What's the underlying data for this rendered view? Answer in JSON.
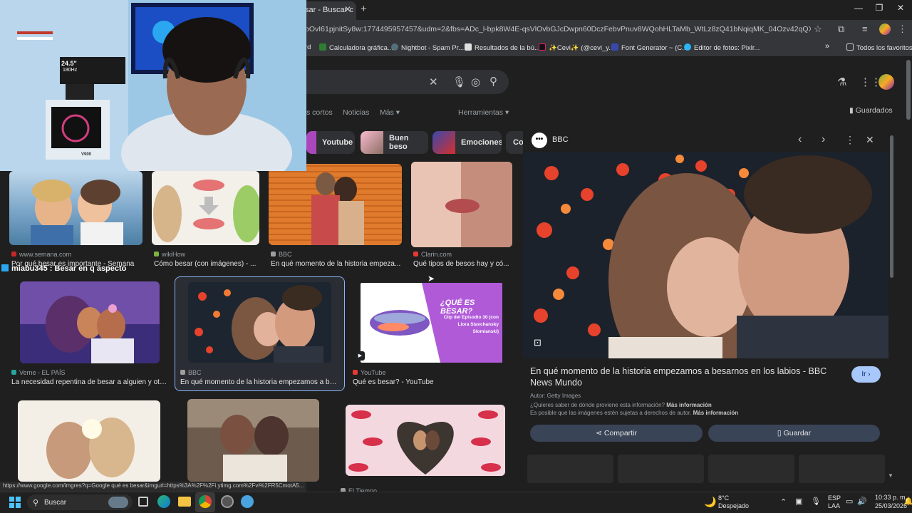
{
  "browser": {
    "tab_title": "sar - Buscar c",
    "new_tab": "+",
    "url": "bOvI61pjnitSy8w:1774495957457&udm=2&fbs=ADc_l-bpk8W4E-qsVlOvbGJcDwpn60DczFebvPnuv8WQohHLTaMb_WtLz8zQ41bNqiqMK_04Ozv42qQXGXRTVAFht9zrPUQ...",
    "bookmarks": [
      {
        "label": "rd",
        "icon": "folder-icon"
      },
      {
        "label": "Calculadora gráfica...",
        "icon": "desmos-icon"
      },
      {
        "label": "Nightbot - Spam Pr...",
        "icon": "nightbot-icon"
      },
      {
        "label": "Resultados de la bú...",
        "icon": "bookmark-icon"
      },
      {
        "label": "✨Cevi✨ (@cevi_y...",
        "icon": "tiktok-icon"
      },
      {
        "label": "Font Generator ~ (C...",
        "icon": "font-icon"
      },
      {
        "label": "Editor de fotos: Pixlr...",
        "icon": "pixlr-icon"
      }
    ],
    "bookmarks_more": "»",
    "all_favorites": "Todos los favoritos"
  },
  "google": {
    "nav_tabs": [
      "s cortos",
      "Noticias",
      "Más ▾"
    ],
    "tools": "Herramientas ▾",
    "saved": "Guardados",
    "chips": [
      "Youtube",
      "Buen beso",
      "Emociones",
      "Co"
    ]
  },
  "results": [
    {
      "source": "www.semana.com",
      "caption": "Por qué besar es importante - Semana",
      "color": "#c62828"
    },
    {
      "source": "wikiHow",
      "caption": "Cómo besar (con imágenes) - ...",
      "color": "#7cb342"
    },
    {
      "source": "BBC",
      "caption": "En qué momento de la historia empeza...",
      "color": "#9e9e9e"
    },
    {
      "source": "Clarin.com",
      "caption": "Qué tipos de besos hay y có...",
      "color": "#e53935"
    },
    {
      "source": "Verne - EL PAÍS",
      "caption": "La necesidad repentina de besar a alguien y otra...",
      "color": "#26a69a"
    },
    {
      "source": "BBC",
      "caption": "En qué momento de la historia empezamos a bes...",
      "color": "#9e9e9e"
    },
    {
      "source": "YouTube",
      "caption": "Qué es besar? - YouTube",
      "color": "#e53935"
    },
    {
      "source": "El Tiempo",
      "caption": "",
      "color": "#9e9e9e"
    }
  ],
  "thumb_texts": {
    "que_es_besar": "¿QUÉ ES BESAR?",
    "clip": "Clip del Episodio 30 (con Liora Stavchansky Slomianski)"
  },
  "panel": {
    "source": "BBC",
    "title": "En qué momento de la historia empezamos a besarnos en los labios - BBC News Mundo",
    "go": "Ir ›",
    "author": "Autor: Getty Images",
    "info1": "¿Quieres saber de dónde proviene esta información?",
    "info1_link": "Más información",
    "info2": "Es posible que las imágenes estén sujetas a derechos de autor.",
    "info2_link": "Más información",
    "share": "Compartir",
    "save": "Guardar"
  },
  "stream": {
    "caption": "miabu345 : Besar en q aspecto",
    "monitor_label": "24.5\"",
    "monitor_sub": "180Hz",
    "box_label": "V900"
  },
  "status_url": "https://www.google.com/imgres?q=Google qué es besar&imgurl=https%3A%2F%2Fi.ytimg.com%2Fvi%2FR5CmotA5...",
  "taskbar": {
    "search": "Buscar",
    "weather_temp": "8°C",
    "weather_desc": "Despejado",
    "lang": "ESP",
    "lang2": "LAA",
    "time": "10:33 p. m.",
    "date": "25/03/2026"
  }
}
